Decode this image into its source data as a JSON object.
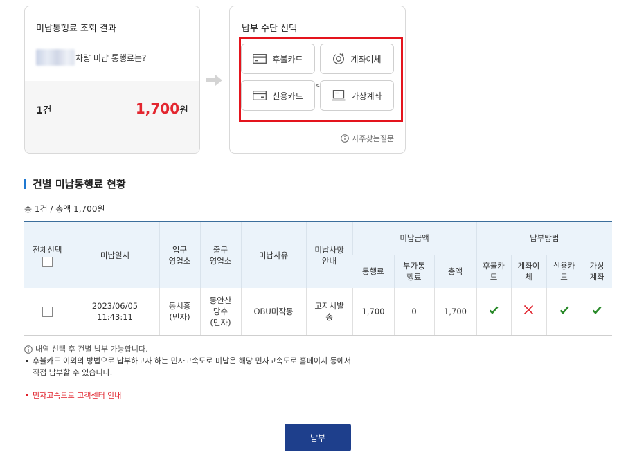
{
  "result": {
    "title": "미납통행료 조회 결과",
    "subtitle_suffix": "차량 미납 통행료는?",
    "count_value": "1",
    "count_unit": "건",
    "amount_value": "1,700",
    "amount_unit": "원"
  },
  "payment_methods": {
    "title": "납부 수단 선택",
    "options": [
      {
        "label": "후불카드",
        "icon": "card-icon"
      },
      {
        "label": "계좌이체",
        "icon": "transfer-icon"
      },
      {
        "label": "신용카드",
        "icon": "credit-card-icon"
      },
      {
        "label": "가상계좌",
        "icon": "virtual-account-icon"
      }
    ],
    "faq_label": "자주찾는질문"
  },
  "section": {
    "title": "건별 미납통행료 현황",
    "summary": "총 1건 / 총액 1,700원"
  },
  "table": {
    "headers": {
      "select_all": "전체선택",
      "date": "미납일시",
      "entry_office": "입구\n영업소",
      "exit_office": "출구\n영업소",
      "reason": "미납사유",
      "notice": "미납사항\n안내",
      "unpaid_amount": "미납금액",
      "toll": "통행료",
      "surcharge": "부가통\n행료",
      "total": "총액",
      "payment_method": "납부방법",
      "postpaid_card": "후불카\n드",
      "account_transfer": "계좌이\n체",
      "credit_card": "신용카\n드",
      "virtual_account": "가상\n계좌"
    },
    "rows": [
      {
        "date": "2023/06/05 11:43:11",
        "entry_office": "동시흥\n(민자)",
        "exit_office": "동안산\n당수\n(민자)",
        "reason": "OBU미작동",
        "notice": "고지서발\n송",
        "toll": "1,700",
        "surcharge": "0",
        "total": "1,700",
        "postpaid_card": "check",
        "account_transfer": "cross",
        "credit_card": "check",
        "virtual_account": "check"
      }
    ]
  },
  "notes": {
    "info": "내역 선택 후 건별 납부 가능합니다.",
    "bullet": "후불카드 이외의 방법으로 납부하고자 하는 민자고속도로 미납은 해당 민자고속도로 홈페이지 등에서\n직접 납부할 수 있습니다.",
    "link": "민자고속도로 고객센터 안내"
  },
  "pay_button": "납부",
  "colors": {
    "accent_red": "#e3262f",
    "highlight_border": "#e4141d",
    "primary_button": "#1e3f8c",
    "check_green": "#2a8a2a",
    "cross_red": "#e0202a",
    "section_bar": "#1f78d1"
  }
}
